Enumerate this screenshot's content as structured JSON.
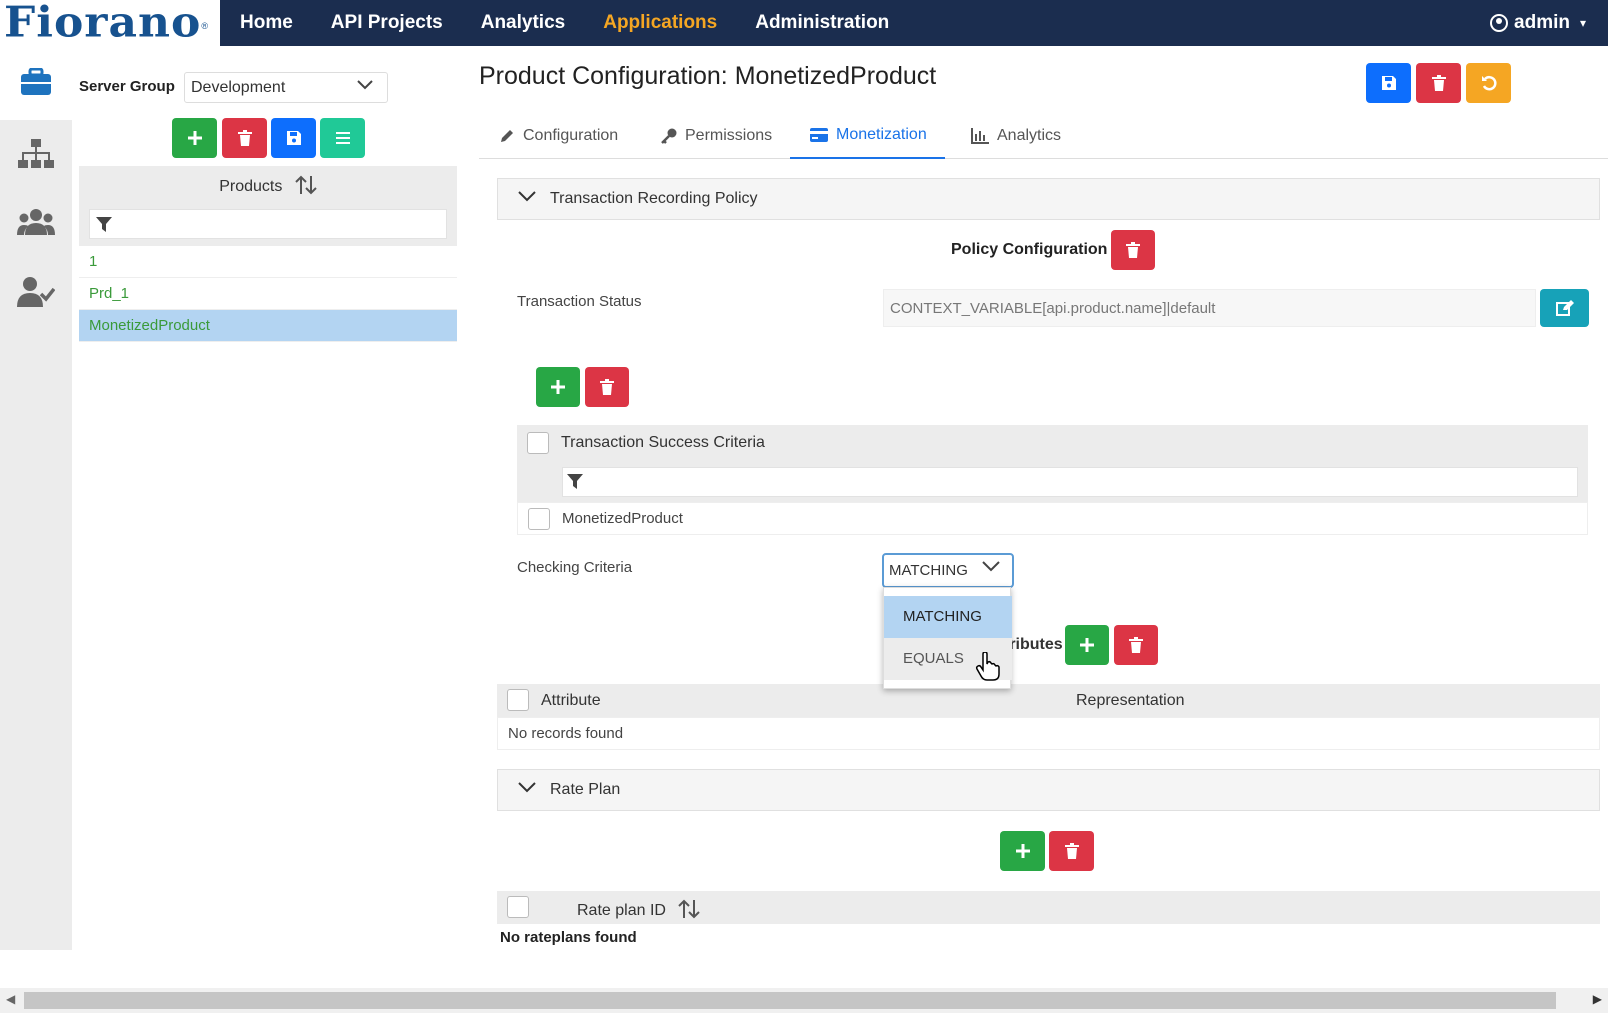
{
  "app": {
    "logo_text": "Fiorano"
  },
  "nav": {
    "items": [
      "Home",
      "API Projects",
      "Analytics",
      "Applications",
      "Administration"
    ],
    "active": "Applications"
  },
  "user": {
    "name": "admin"
  },
  "left": {
    "server_group_label": "Server Group",
    "server_group_value": "Development",
    "products_header": "Products",
    "products": [
      "1",
      "Prd_1",
      "MonetizedProduct"
    ],
    "selected_product": "MonetizedProduct"
  },
  "main": {
    "title": "Product Configuration: MonetizedProduct",
    "tabs": [
      "Configuration",
      "Permissions",
      "Monetization",
      "Analytics"
    ],
    "active_tab": "Monetization",
    "trp": {
      "section_title": "Transaction Recording Policy",
      "policy_config_label": "Policy Configuration",
      "transaction_status_label": "Transaction Status",
      "transaction_status_value": "CONTEXT_VARIABLE[api.product.name]|default",
      "tsc_header": "Transaction Success Criteria",
      "tsc_rows": [
        "MonetizedProduct"
      ],
      "checking_criteria_label": "Checking Criteria",
      "checking_criteria_value": "MATCHING",
      "checking_criteria_options": [
        "MATCHING",
        "EQUALS"
      ],
      "attributes_label_partial": "tributes",
      "attr_col_attribute": "Attribute",
      "attr_col_representation": "Representation",
      "attr_empty": "No records found"
    },
    "rate_plan": {
      "section_title": "Rate Plan",
      "col_id": "Rate plan ID",
      "empty": "No rateplans found"
    }
  },
  "colors": {
    "nav_bg": "#1b2d4f",
    "active_nav": "#f5a623",
    "add": "#28a745",
    "delete": "#dc3545",
    "save": "#0d6efd",
    "selected_row": "#b3d4f2"
  }
}
